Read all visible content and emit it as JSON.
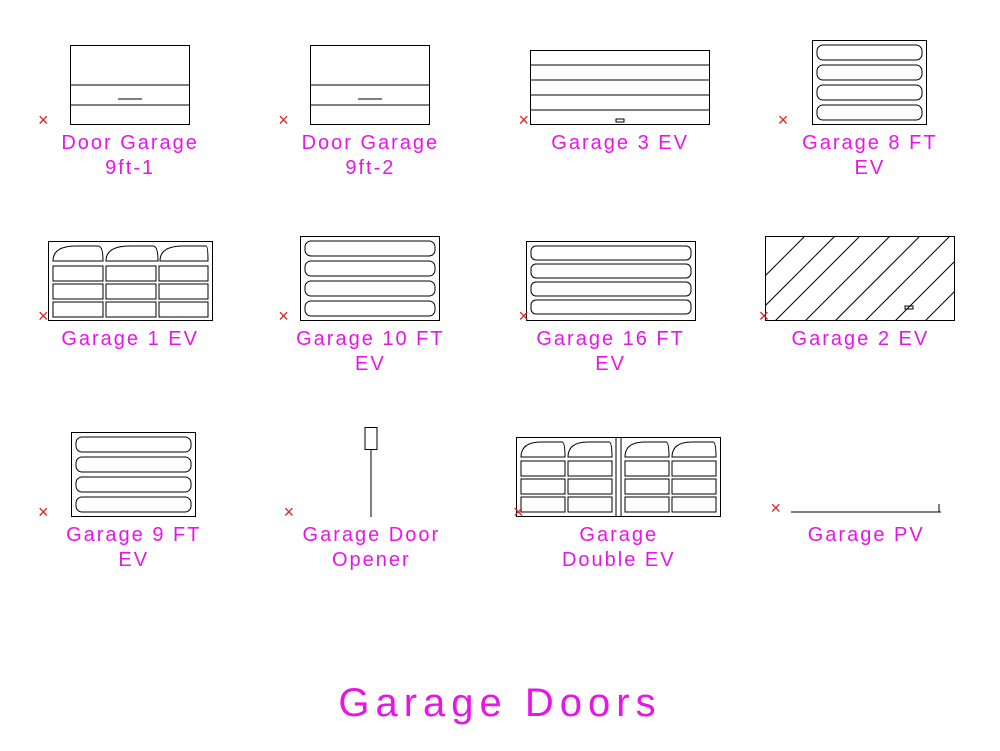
{
  "title": "Garage Doors",
  "blocks": [
    {
      "id": "door-garage-9ft-1",
      "label": "Door Garage\n9ft-1"
    },
    {
      "id": "door-garage-9ft-2",
      "label": "Door Garage\n9ft-2"
    },
    {
      "id": "garage-3-ev",
      "label": "Garage 3 EV"
    },
    {
      "id": "garage-8-ft-ev",
      "label": "Garage 8 FT\nEV"
    },
    {
      "id": "garage-1-ev",
      "label": "Garage 1 EV"
    },
    {
      "id": "garage-10-ft-ev",
      "label": "Garage 10 FT\nEV"
    },
    {
      "id": "garage-16-ft-ev",
      "label": "Garage 16 FT\nEV"
    },
    {
      "id": "garage-2-ev",
      "label": "Garage 2 EV"
    },
    {
      "id": "garage-9-ft-ev",
      "label": "Garage 9 FT\nEV"
    },
    {
      "id": "garage-door-opener",
      "label": "Garage Door\nOpener"
    },
    {
      "id": "garage-double-ev",
      "label": "Garage\nDouble EV"
    },
    {
      "id": "garage-pv",
      "label": "Garage PV"
    }
  ]
}
